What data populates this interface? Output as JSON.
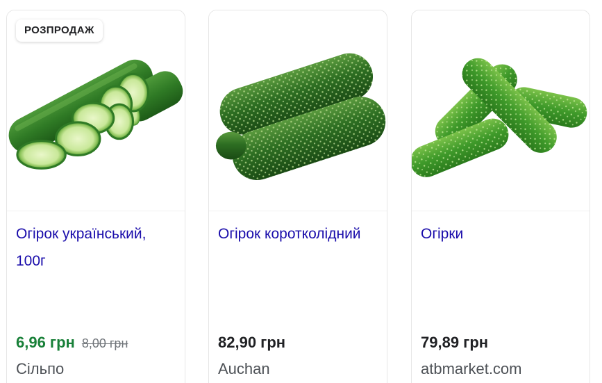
{
  "products": [
    {
      "badge": "РОЗПРОДАЖ",
      "title": "Огірок український, 100г",
      "price": "6,96 грн",
      "old_price": "8,00 грн",
      "store": "Сільпо",
      "image": "cucumber-sliced-image"
    },
    {
      "title": "Огірок коротколідний",
      "price": "82,90 грн",
      "store": "Auchan",
      "image": "cucumbers-pair-image"
    },
    {
      "title": "Огірки",
      "price": "79,89 грн",
      "store": "atbmarket.com",
      "image": "cucumbers-pile-image"
    }
  ],
  "colors": {
    "link_title": "#1a0dab",
    "sale_price": "#188038",
    "price": "#202124",
    "old_price": "#70757a",
    "store": "#4d5156"
  }
}
